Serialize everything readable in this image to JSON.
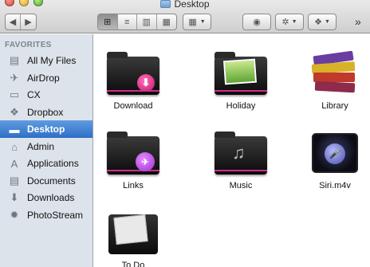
{
  "window": {
    "title": "Desktop"
  },
  "toolbar": {
    "back_glyph": "◀",
    "forward_glyph": "▶",
    "views": [
      {
        "name": "icon-view",
        "glyph": "⊞",
        "active": true
      },
      {
        "name": "list-view",
        "glyph": "≡",
        "active": false
      },
      {
        "name": "column-view",
        "glyph": "▥",
        "active": false
      },
      {
        "name": "coverflow-view",
        "glyph": "▦",
        "active": false
      }
    ],
    "arrange_glyph": "▦",
    "quicklook_glyph": "◉",
    "action_glyph": "✲",
    "dropbox_glyph": "❖",
    "more_glyph": "»"
  },
  "sidebar": {
    "header": "FAVORITES",
    "items": [
      {
        "label": "All My Files",
        "icon": "all-files-icon",
        "glyph": "▤"
      },
      {
        "label": "AirDrop",
        "icon": "airdrop-icon",
        "glyph": "✈"
      },
      {
        "label": "CX",
        "icon": "folder-icon",
        "glyph": "▭"
      },
      {
        "label": "Dropbox",
        "icon": "dropbox-icon",
        "glyph": "❖"
      },
      {
        "label": "Desktop",
        "icon": "desktop-icon",
        "glyph": "▬",
        "selected": true
      },
      {
        "label": "Admin",
        "icon": "home-icon",
        "glyph": "⌂"
      },
      {
        "label": "Applications",
        "icon": "applications-icon",
        "glyph": "A"
      },
      {
        "label": "Documents",
        "icon": "documents-icon",
        "glyph": "▤"
      },
      {
        "label": "Downloads",
        "icon": "downloads-icon",
        "glyph": "⬇"
      },
      {
        "label": "PhotoStream",
        "icon": "photostream-icon",
        "glyph": "✹"
      }
    ]
  },
  "files": [
    {
      "label": "Download",
      "icon": "download-folder-icon"
    },
    {
      "label": "Holiday",
      "icon": "holiday-folder-icon"
    },
    {
      "label": "Library",
      "icon": "library-books-icon"
    },
    {
      "label": "Links",
      "icon": "links-folder-icon"
    },
    {
      "label": "Music",
      "icon": "music-folder-icon"
    },
    {
      "label": "Siri.m4v",
      "icon": "video-file-icon"
    },
    {
      "label": "To Do",
      "icon": "todo-folder-icon"
    }
  ],
  "colors": {
    "selection": "#2f6fc6",
    "sidebar_bg": "#dde3ea",
    "folder_accent": "#d02c8b"
  }
}
